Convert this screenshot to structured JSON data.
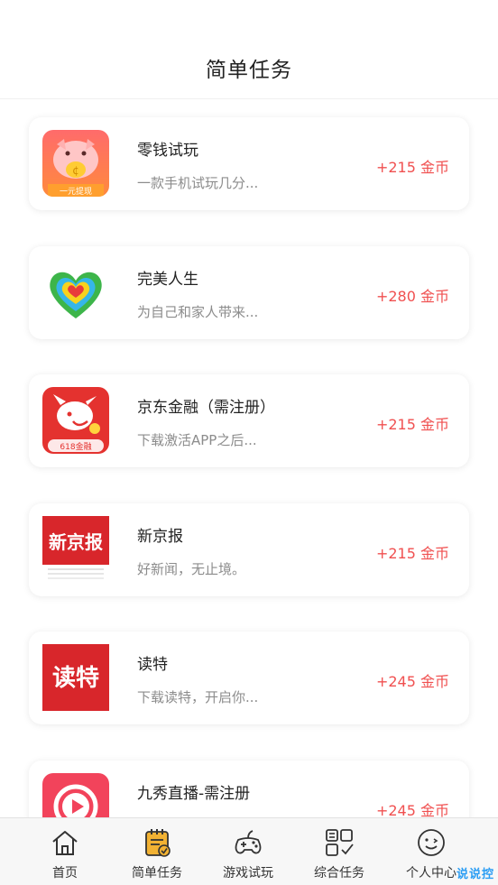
{
  "header": {
    "title": "简单任务"
  },
  "tasks": [
    {
      "name": "零钱试玩",
      "desc": "一款手机试玩几分...",
      "reward": "+215 金币",
      "logo_caption": "一元提现"
    },
    {
      "name": "完美人生",
      "desc": "为自己和家人带来...",
      "reward": "+280 金币"
    },
    {
      "name": "京东金融（需注册）",
      "desc": "下载激活APP之后...",
      "reward": "+215 金币",
      "logo_caption": "618金融"
    },
    {
      "name": "新京报",
      "desc": "好新闻，无止境。",
      "reward": "+215 金币",
      "logo_text": "新京报"
    },
    {
      "name": "读特",
      "desc": "下载读特，开启你...",
      "reward": "+245 金币",
      "logo_text": "读特"
    },
    {
      "name": "九秀直播-需注册",
      "desc": "",
      "reward": "+245 金币"
    }
  ],
  "tabs": [
    {
      "label": "首页",
      "icon": "home-icon"
    },
    {
      "label": "简单任务",
      "icon": "task-list-icon",
      "active": true
    },
    {
      "label": "游戏试玩",
      "icon": "gamepad-icon"
    },
    {
      "label": "综合任务",
      "icon": "grid-check-icon"
    },
    {
      "label": "个人中心",
      "icon": "smiley-icon"
    }
  ],
  "colors": {
    "reward": "#f05050",
    "active_tab_icon": "#f2b233"
  },
  "watermark": "说说控"
}
